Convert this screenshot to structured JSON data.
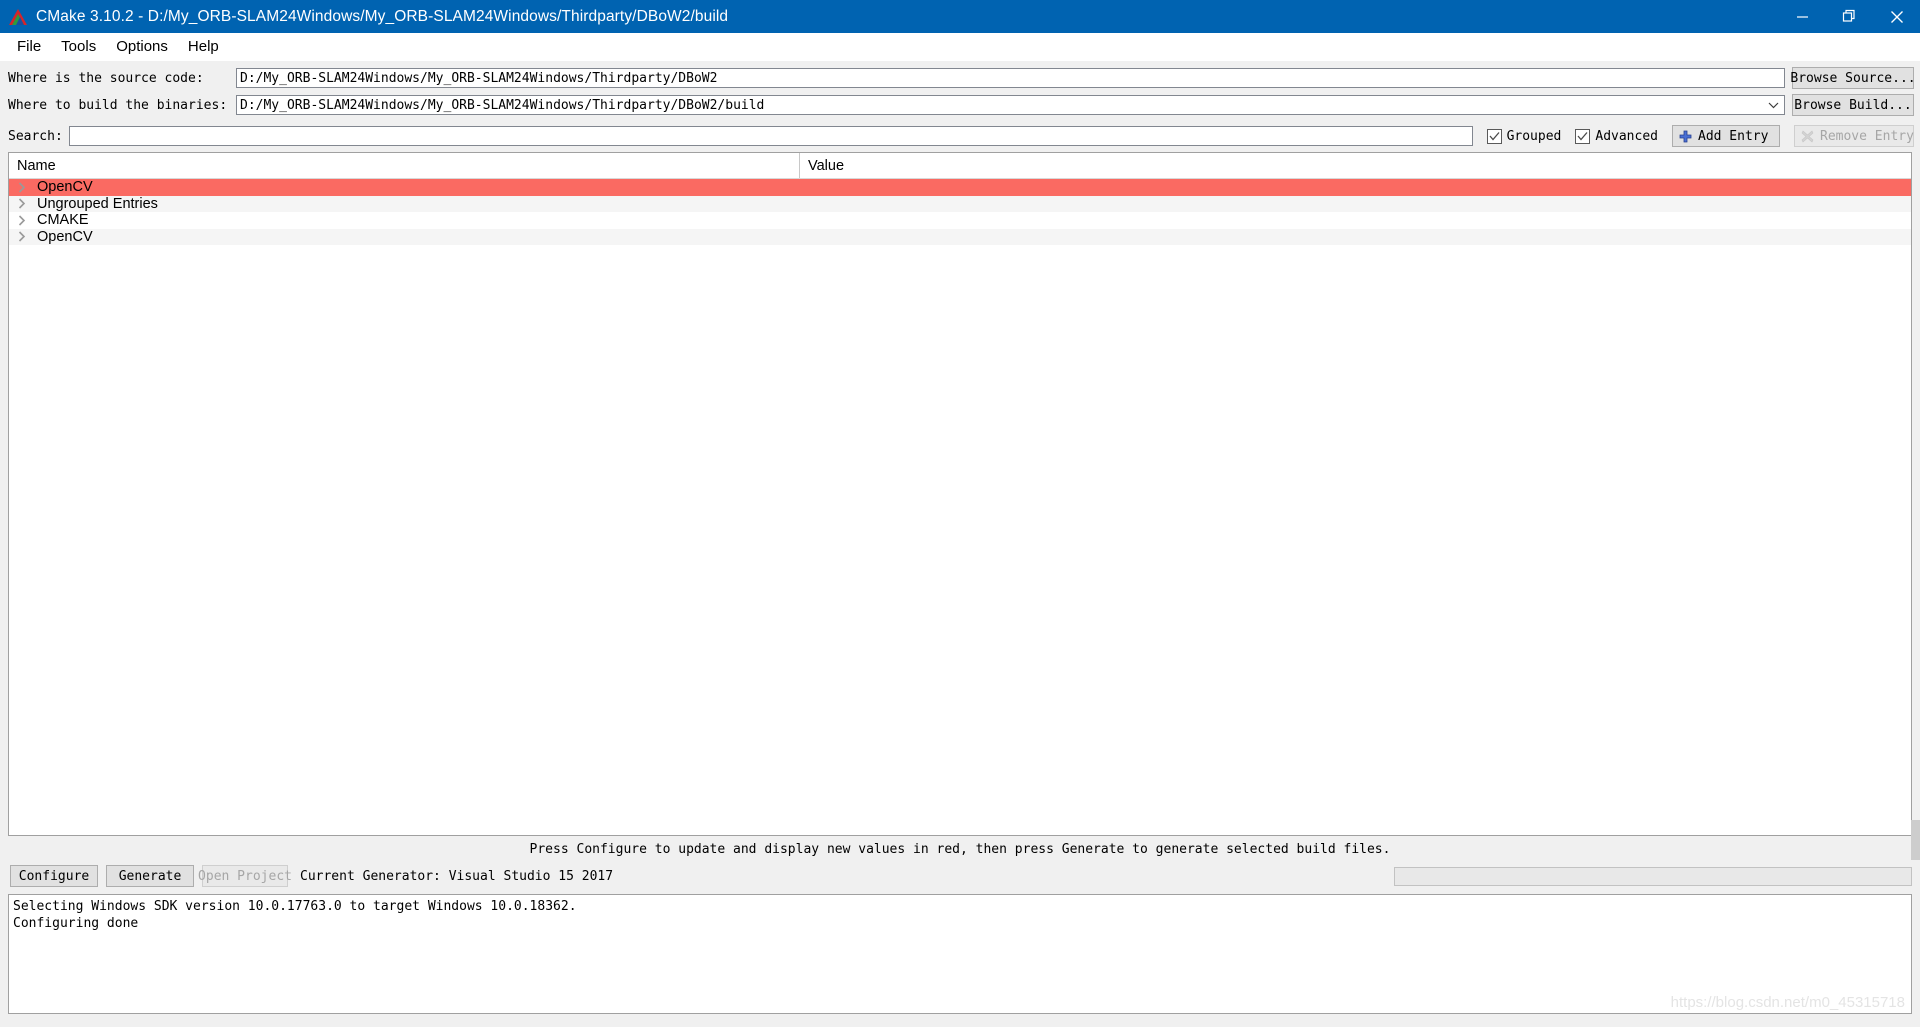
{
  "window": {
    "title": "CMake 3.10.2 - D:/My_ORB-SLAM24Windows/My_ORB-SLAM24Windows/Thirdparty/DBoW2/build",
    "icon": "cmake-logo-icon",
    "minimize": "minimize-icon",
    "restore": "restore-icon",
    "close": "close-icon",
    "titlebar_color": "#0063b1"
  },
  "menu": {
    "items": [
      {
        "label": "File"
      },
      {
        "label": "Tools"
      },
      {
        "label": "Options"
      },
      {
        "label": "Help"
      }
    ]
  },
  "paths": {
    "source": {
      "label": "Where is the source code:",
      "value": "D:/My_ORB-SLAM24Windows/My_ORB-SLAM24Windows/Thirdparty/DBoW2",
      "browse_label": "Browse Source..."
    },
    "build": {
      "label": "Where to build the binaries:",
      "value": "D:/My_ORB-SLAM24Windows/My_ORB-SLAM24Windows/Thirdparty/DBoW2/build",
      "browse_label": "Browse Build..."
    }
  },
  "search": {
    "label": "Search:",
    "value": "",
    "placeholder": ""
  },
  "toolbar": {
    "grouped_label": "Grouped",
    "grouped_checked": true,
    "advanced_label": "Advanced",
    "advanced_checked": true,
    "add_entry_label": "Add Entry",
    "remove_entry_label": "Remove Entry",
    "remove_entry_enabled": false
  },
  "cache": {
    "columns": [
      {
        "label": "Name"
      },
      {
        "label": "Value"
      }
    ],
    "highlight_color": "#fa6a62",
    "rows": [
      {
        "name": "OpenCV",
        "value": "",
        "highlighted": true,
        "expanded": false
      },
      {
        "name": "Ungrouped Entries",
        "value": "",
        "highlighted": false,
        "expanded": false
      },
      {
        "name": "CMAKE",
        "value": "",
        "highlighted": false,
        "expanded": false
      },
      {
        "name": "OpenCV",
        "value": "",
        "highlighted": false,
        "expanded": false
      }
    ]
  },
  "status": {
    "message": "Press Configure to update and display new values in red, then press Generate to generate selected build files."
  },
  "actions": {
    "configure_label": "Configure",
    "generate_label": "Generate",
    "open_project_label": "Open Project",
    "open_project_enabled": false,
    "generator_text": "Current Generator: Visual Studio 15 2017",
    "progress_percent": 0
  },
  "output": {
    "lines": "Selecting Windows SDK version 10.0.17763.0 to target Windows 10.0.18362.\nConfiguring done",
    "watermark": "https://blog.csdn.net/m0_45315718"
  }
}
